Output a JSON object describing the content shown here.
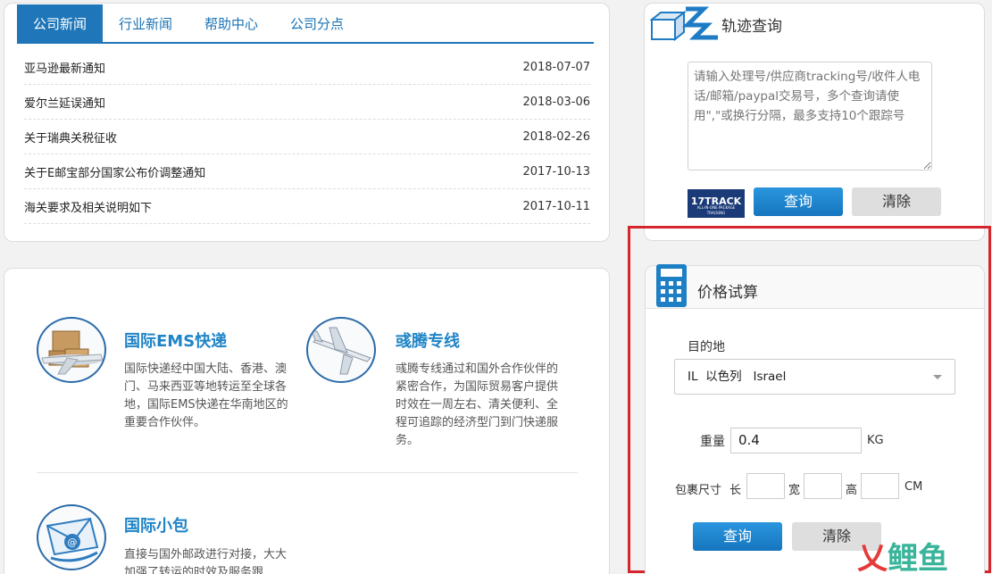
{
  "news": {
    "tabs": [
      {
        "label": "公司新闻",
        "active": true
      },
      {
        "label": "行业新闻",
        "active": false
      },
      {
        "label": "帮助中心",
        "active": false
      },
      {
        "label": "公司分点",
        "active": false
      }
    ],
    "items": [
      {
        "title": "亚马逊最新通知",
        "date": "2018-07-07"
      },
      {
        "title": "爱尔兰延误通知",
        "date": "2018-03-06"
      },
      {
        "title": "关于瑞典关税征收",
        "date": "2018-02-26"
      },
      {
        "title": "关于E邮宝部分国家公布价调整通知",
        "date": "2017-10-13"
      },
      {
        "title": "海关要求及相关说明如下",
        "date": "2017-10-11"
      }
    ]
  },
  "track": {
    "title": "轨迹查询",
    "placeholder": "请输入处理号/供应商tracking号/收件人电话/邮箱/paypal交易号，多个查询请使用\",\"或换行分隔，最多支持10个跟踪号",
    "logo_text": "17TRACK",
    "logo_sub": "ALL-IN-ONE PACKAGE TRACKING",
    "query_label": "查询",
    "clear_label": "清除"
  },
  "services": [
    {
      "icon": "airplane-boxes-icon",
      "title": "国际EMS快递",
      "desc": "国际快递经中国大陆、香港、澳门、马来西亚等地转运至全球各地，国际EMS快递在华南地区的重要合作伙伴。"
    },
    {
      "icon": "airplane-icon",
      "title": "彧腾专线",
      "desc": "彧腾专线通过和国外合作伙伴的紧密合作，为国际贸易客户提供时效在一周左右、清关便利、全程可追踪的经济型门到门快递服务。"
    },
    {
      "icon": "envelope-at-icon",
      "title": "国际小包",
      "desc": "直接与国外邮政进行对接，大大加强了转运的时效及服务跟"
    }
  ],
  "price": {
    "title": "价格试算",
    "dest_label": "目的地",
    "dest_value": "IL  以色列   Israel",
    "weight_label": "重量",
    "weight_value": "0.4",
    "weight_unit": "KG",
    "size_label": "包裹尺寸",
    "length_label": "长",
    "width_label": "宽",
    "height_label": "高",
    "size_unit": "CM",
    "query_label": "查询",
    "clear_label": "清除"
  },
  "watermark": {
    "part1": "乂",
    "part2": "鲤鱼"
  }
}
